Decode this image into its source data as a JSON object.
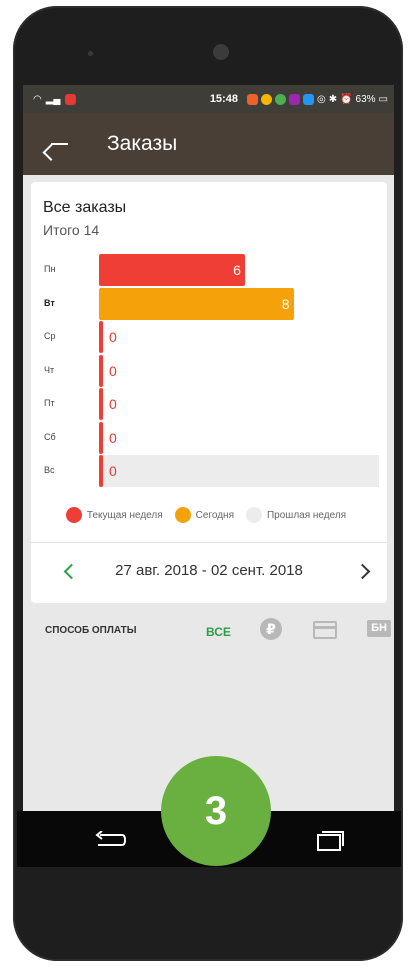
{
  "status_bar": {
    "time": "15:48",
    "battery": "63%"
  },
  "appbar": {
    "title": "Заказы"
  },
  "summary": {
    "title": "Все заказы",
    "total": "Итого 14"
  },
  "chart_data": {
    "type": "bar",
    "orientation": "horizontal",
    "categories": [
      "Пн",
      "Вт",
      "Ср",
      "Чт",
      "Пт",
      "Сб",
      "Вс"
    ],
    "values": [
      6,
      8,
      0,
      0,
      0,
      0,
      0
    ],
    "labels": [
      "6",
      "8",
      "0",
      "0",
      "0",
      "0",
      "0"
    ],
    "xlim": [
      0,
      11.5
    ],
    "highlight_today": "Вт",
    "previous_week_marker": "Вс",
    "colors": {
      "current_week": "#ef3e36",
      "today": "#f5a10a",
      "previous_week": "#ececec"
    },
    "legend": [
      "Текущая неделя",
      "Сегодня",
      "Прошлая неделя"
    ]
  },
  "range": {
    "text": "27 авг. 2018 - 02 сент. 2018"
  },
  "payment": {
    "label": "СПОСОБ ОПЛАТЫ",
    "all": "ВСЕ",
    "ruble": "₽",
    "bn": "БН"
  },
  "badge": {
    "number": "3"
  },
  "icons": [
    "back-arrow-icon",
    "chevron-left-icon",
    "chevron-right-icon",
    "ruble-icon",
    "credit-card-icon",
    "bn-icon",
    "nav-back-icon",
    "nav-recent-icon"
  ]
}
